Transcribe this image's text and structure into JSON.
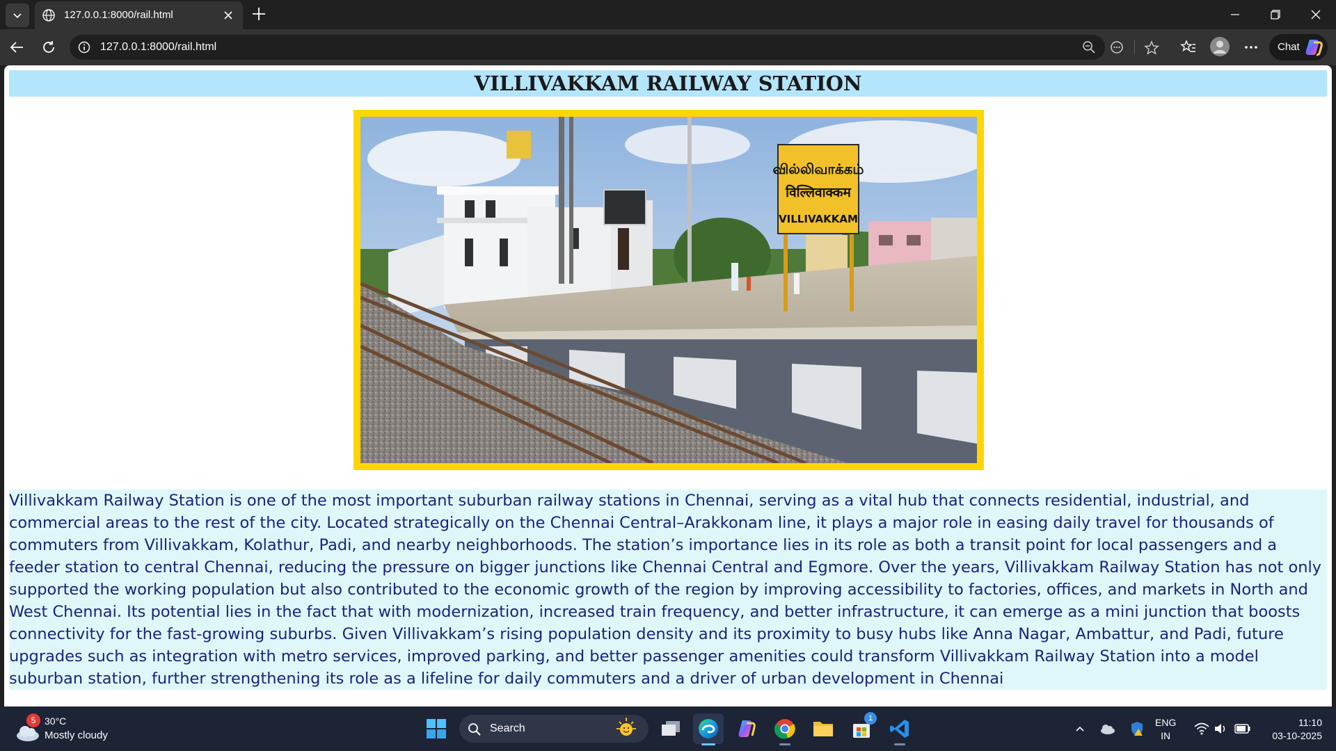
{
  "browser": {
    "tab_title": "127.0.0.1:8000/rail.html",
    "url": "127.0.0.1:8000/rail.html",
    "chat_label": "Chat"
  },
  "page": {
    "heading": "VILLIVAKKAM RAILWAY STATION",
    "image_sign": [
      "வில்லிவாக்கம்",
      "विल्लिवाक्कम",
      "VILLIVAKKAM"
    ],
    "description": "Villivakkam Railway Station is one of the most important suburban railway stations in Chennai, serving as a vital hub that connects residential, industrial, and commercial areas to the rest of the city. Located strategically on the Chennai Central–Arakkonam line, it plays a major role in easing daily travel for thousands of commuters from Villivakkam, Kolathur, Padi, and nearby neighborhoods. The station’s importance lies in its role as both a transit point for local passengers and a feeder station to central Chennai, reducing the pressure on bigger junctions like Chennai Central and Egmore. Over the years, Villivakkam Railway Station has not only supported the working population but also contributed to the economic growth of the region by improving accessibility to factories, offices, and markets in North and West Chennai. Its potential lies in the fact that with modernization, increased train frequency, and better infrastructure, it can emerge as a mini junction that boosts connectivity for the fast-growing suburbs. Given Villivakkam’s rising population density and its proximity to busy hubs like Anna Nagar, Ambattur, and Padi, future upgrades such as integration with metro services, improved parking, and better passenger amenities could transform Villivakkam Railway Station into a model suburban station, further strengthening its role as a lifeline for daily commuters and a driver of urban development in Chennai"
  },
  "taskbar": {
    "weather_badge": "5",
    "weather_temp": "30°C",
    "weather_condition": "Mostly cloudy",
    "search_label": "Search",
    "store_badge": "1",
    "lang_top": "ENG",
    "lang_bottom": "IN",
    "time": "11:10",
    "date": "03-10-2025"
  },
  "colors": {
    "heading_bg": "#b3e5fc",
    "frame": "#ffd600",
    "description_bg": "#e0f7fa",
    "description_text": "#1a237e"
  }
}
